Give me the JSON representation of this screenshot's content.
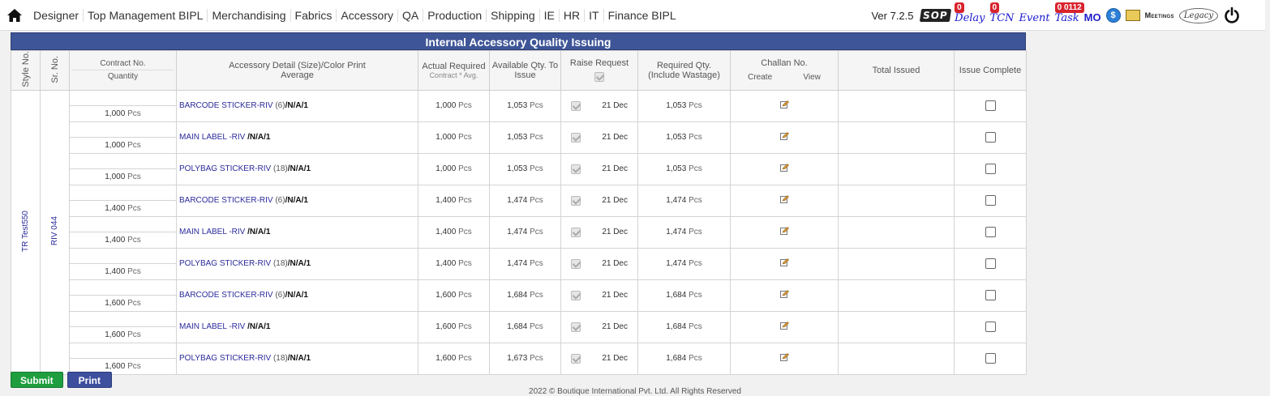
{
  "nav": {
    "items": [
      "Designer",
      "Top Management BIPL",
      "Merchandising",
      "Fabrics",
      "Accessory",
      "QA",
      "Production",
      "Shipping",
      "IE",
      "HR",
      "IT",
      "Finance BIPL"
    ]
  },
  "header": {
    "version": "Ver 7.2.5",
    "sop": "SOP",
    "delay_label": "Delay",
    "delay_count": "0",
    "tcn_label": "TCN",
    "tcn_count": "0",
    "event_label": "Event",
    "task_label": "Task",
    "task_count": "0 0112",
    "mo_label": "MO",
    "meetings_label": "Meetings",
    "legacy_label": "Legacy"
  },
  "page": {
    "title": "Internal Accessory Quality Issuing"
  },
  "table": {
    "headers": {
      "style_no": "Style No.",
      "sr_no": "Sr. No.",
      "contract_no": "Contract No.",
      "quantity": "Quantity",
      "accessory_detail": "Accessory Detail (Size)/Color Print",
      "average": "Average",
      "actual_required": "Actual Required",
      "actual_required_sub": "Contract * Avg.",
      "available_qty": "Available Qty. To Issue",
      "raise_request": "Raise Request",
      "required_qty": "Required Qty. (Include Wastage)",
      "challan_no": "Challan No.",
      "challan_create": "Create",
      "challan_view": "View",
      "total_issued": "Total Issued",
      "issue_complete": "Issue Complete"
    },
    "style_no": "TR Test550",
    "sr_no": "RIV 044",
    "rows": [
      {
        "quantity": "1,000",
        "unit": "Pcs",
        "name": "BARCODE STICKER-RIV",
        "size": " (6)",
        "color": "/N/A/",
        "avg": "1",
        "actual": "1,000",
        "actual_unit": "Pcs",
        "available": "1,053",
        "available_unit": "Pcs",
        "date": "21 Dec",
        "required": "1,053",
        "required_unit": "Pcs"
      },
      {
        "quantity": "1,000",
        "unit": "Pcs",
        "name": "MAIN LABEL -RIV",
        "size": " ",
        "color": "/N/A/",
        "avg": "1",
        "actual": "1,000",
        "actual_unit": "Pcs",
        "available": "1,053",
        "available_unit": "Pcs",
        "date": "21 Dec",
        "required": "1,053",
        "required_unit": "Pcs"
      },
      {
        "quantity": "1,000",
        "unit": "Pcs",
        "name": "POLYBAG STICKER-RIV",
        "size": " (18)",
        "color": "/N/A/",
        "avg": "1",
        "actual": "1,000",
        "actual_unit": "Pcs",
        "available": "1,053",
        "available_unit": "Pcs",
        "date": "21 Dec",
        "required": "1,053",
        "required_unit": "Pcs"
      },
      {
        "quantity": "1,400",
        "unit": "Pcs",
        "name": "BARCODE STICKER-RIV",
        "size": " (6)",
        "color": "/N/A/",
        "avg": "1",
        "actual": "1,400",
        "actual_unit": "Pcs",
        "available": "1,474",
        "available_unit": "Pcs",
        "date": "21 Dec",
        "required": "1,474",
        "required_unit": "Pcs"
      },
      {
        "quantity": "1,400",
        "unit": "Pcs",
        "name": "MAIN LABEL -RIV",
        "size": " ",
        "color": "/N/A/",
        "avg": "1",
        "actual": "1,400",
        "actual_unit": "Pcs",
        "available": "1,474",
        "available_unit": "Pcs",
        "date": "21 Dec",
        "required": "1,474",
        "required_unit": "Pcs"
      },
      {
        "quantity": "1,400",
        "unit": "Pcs",
        "name": "POLYBAG STICKER-RIV",
        "size": " (18)",
        "color": "/N/A/",
        "avg": "1",
        "actual": "1,400",
        "actual_unit": "Pcs",
        "available": "1,474",
        "available_unit": "Pcs",
        "date": "21 Dec",
        "required": "1,474",
        "required_unit": "Pcs"
      },
      {
        "quantity": "1,600",
        "unit": "Pcs",
        "name": "BARCODE STICKER-RIV",
        "size": " (6)",
        "color": "/N/A/",
        "avg": "1",
        "actual": "1,600",
        "actual_unit": "Pcs",
        "available": "1,684",
        "available_unit": "Pcs",
        "date": "21 Dec",
        "required": "1,684",
        "required_unit": "Pcs"
      },
      {
        "quantity": "1,600",
        "unit": "Pcs",
        "name": "MAIN LABEL -RIV",
        "size": " ",
        "color": "/N/A/",
        "avg": "1",
        "actual": "1,600",
        "actual_unit": "Pcs",
        "available": "1,684",
        "available_unit": "Pcs",
        "date": "21 Dec",
        "required": "1,684",
        "required_unit": "Pcs"
      },
      {
        "quantity": "1,600",
        "unit": "Pcs",
        "name": "POLYBAG STICKER-RIV",
        "size": " (18)",
        "color": "/N/A/",
        "avg": "1",
        "actual": "1,600",
        "actual_unit": "Pcs",
        "available": "1,673",
        "available_unit": "Pcs",
        "date": "21 Dec",
        "required": "1,684",
        "required_unit": "Pcs"
      }
    ]
  },
  "actions": {
    "submit": "Submit",
    "print": "Print"
  },
  "footer": {
    "text": "2022 © Boutique International Pvt. Ltd. All Rights Reserved"
  },
  "colors": {
    "title_bar": "#3e5597",
    "submit": "#1e9e3f",
    "print": "#3e4f9e",
    "link": "#2a2a9c",
    "badge": "#d9232d"
  }
}
